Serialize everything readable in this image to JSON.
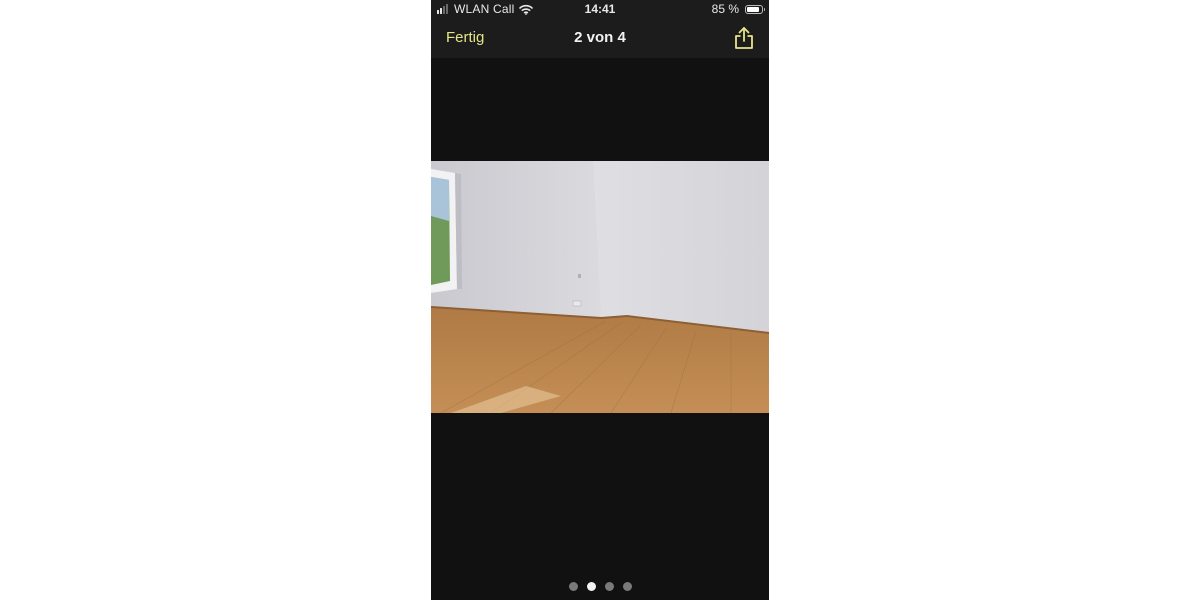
{
  "status_bar": {
    "carrier": "WLAN Call",
    "time": "14:41",
    "battery_percent": "85 %",
    "battery_level": 0.85,
    "signal_bars_active": 2,
    "signal_bars_total": 4
  },
  "nav": {
    "done_label": "Fertig",
    "title": "2 von 4",
    "share_icon": "share-icon"
  },
  "viewer": {
    "current_page": 2,
    "total_pages": 4
  },
  "colors": {
    "accent": "#e6e58b",
    "background": "#111111",
    "bar": "#1c1c1c"
  }
}
